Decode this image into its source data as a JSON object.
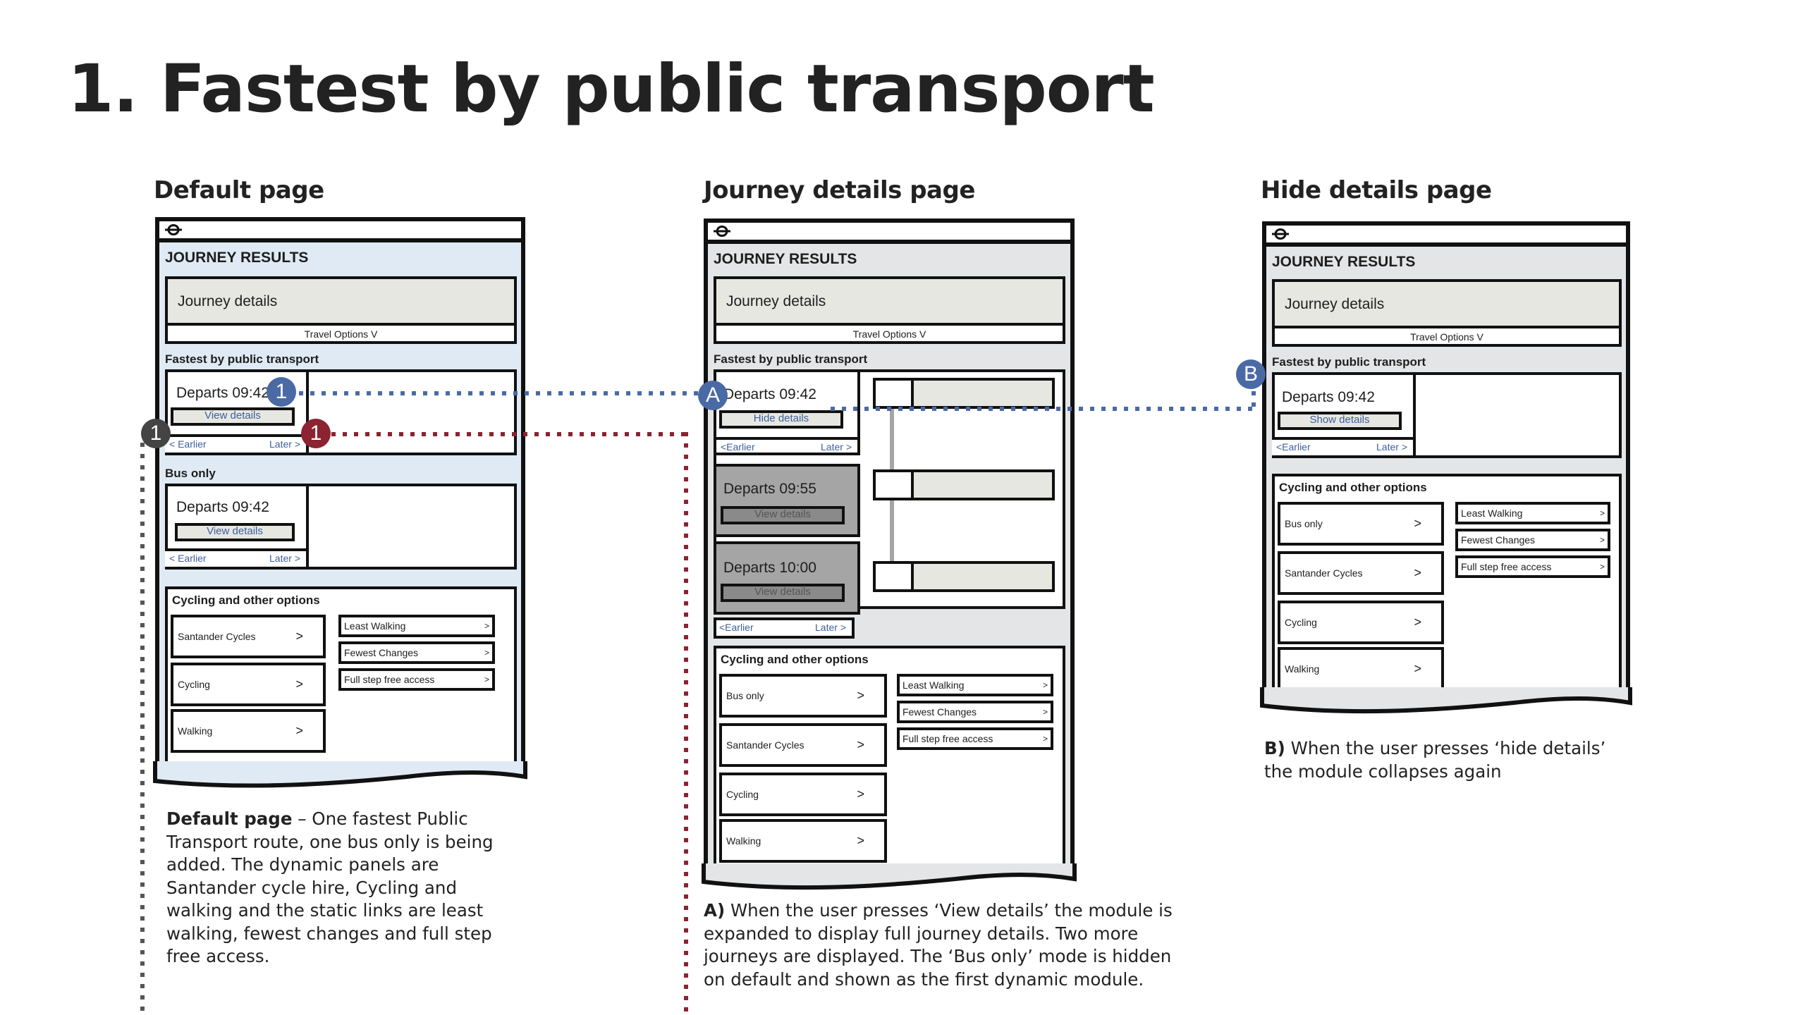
{
  "title": "1. Fastest by public transport",
  "colors": {
    "default_bg": "#dfeaf4",
    "alt_bg": "#e4e5e6",
    "panel_fill": "#e7e7e2",
    "dark_card": "#a5a5a5",
    "link_blue": "#3d5f9b",
    "badge_blue": "#4a6aa5",
    "badge_red": "#8b2330",
    "badge_gray": "#444444"
  },
  "panels": [
    {
      "heading": "Default page",
      "journey_results": "JOURNEY RESULTS",
      "journey_details": "Journey details",
      "travel_options": "Travel Options   V",
      "fastest_label": "Fastest by public transport",
      "fastest_card": {
        "departs": "Departs 09:42",
        "button": "View details",
        "earlier": "< Earlier",
        "later": "Later >"
      },
      "bus_label": "Bus only",
      "bus_card": {
        "departs": "Departs 09:42",
        "button": "View details",
        "earlier": "< Earlier",
        "later": "Later >"
      },
      "other_options_title": "Cycling and other options",
      "dynamic_modules": [
        "Santander Cycles",
        "Cycling",
        "Walking"
      ],
      "static_links": [
        "Least Walking",
        "Fewest Changes",
        "Full step free access"
      ],
      "chevron": ">",
      "description_bold": "Default page",
      "description": " – One fastest Public Transport route, one bus only is being added. The dynamic panels are Santander cycle hire, Cycling and walking and the static links are least walking, fewest changes and full step free access."
    },
    {
      "heading": "Journey details page",
      "journey_results": "JOURNEY RESULTS",
      "journey_details": "Journey details",
      "travel_options": "Travel Options   V",
      "fastest_label": "Fastest by public transport",
      "journeys": [
        {
          "departs": "Departs 09:42",
          "button": "Hide details",
          "earlier": "<Earlier",
          "later": "Later >"
        },
        {
          "departs": "Departs 09:55",
          "button": "View details"
        },
        {
          "departs": "Departs 10:00",
          "button": "View details"
        }
      ],
      "pager": {
        "earlier": "<Earlier",
        "later": "Later >"
      },
      "other_options_title": "Cycling and other options",
      "dynamic_modules": [
        "Bus only",
        "Santander Cycles",
        "Cycling",
        "Walking"
      ],
      "static_links": [
        "Least Walking",
        "Fewest Changes",
        "Full step free access"
      ],
      "chevron": ">",
      "description_bold": "A)",
      "description": " When the user presses ‘View details’ the module is expanded to display full journey details. Two more journeys are displayed. The ‘Bus only’ mode is hidden on default and shown as the first dynamic module."
    },
    {
      "heading": "Hide details page",
      "journey_results": "JOURNEY RESULTS",
      "journey_details": "Journey details",
      "travel_options": "Travel Options   V",
      "fastest_label": "Fastest by public transport",
      "fastest_card": {
        "departs": "Departs 09:42",
        "button": "Show details",
        "earlier": "<Earlier",
        "later": "Later >"
      },
      "other_options_title": "Cycling and other options",
      "dynamic_modules": [
        "Bus only",
        "Santander Cycles",
        "Cycling",
        "Walking"
      ],
      "static_links": [
        "Least Walking",
        "Fewest Changes",
        "Full step free access"
      ],
      "chevron": ">",
      "description_bold": "B)",
      "description": " When the user presses ‘hide details’ the module collapses again"
    }
  ],
  "badges": {
    "blue_1": "1",
    "red_1": "1",
    "gray_1": "1",
    "a": "A",
    "b": "B"
  },
  "icons": {
    "logo": "tfl-roundel-icon",
    "chevron": "chevron-right-icon"
  }
}
